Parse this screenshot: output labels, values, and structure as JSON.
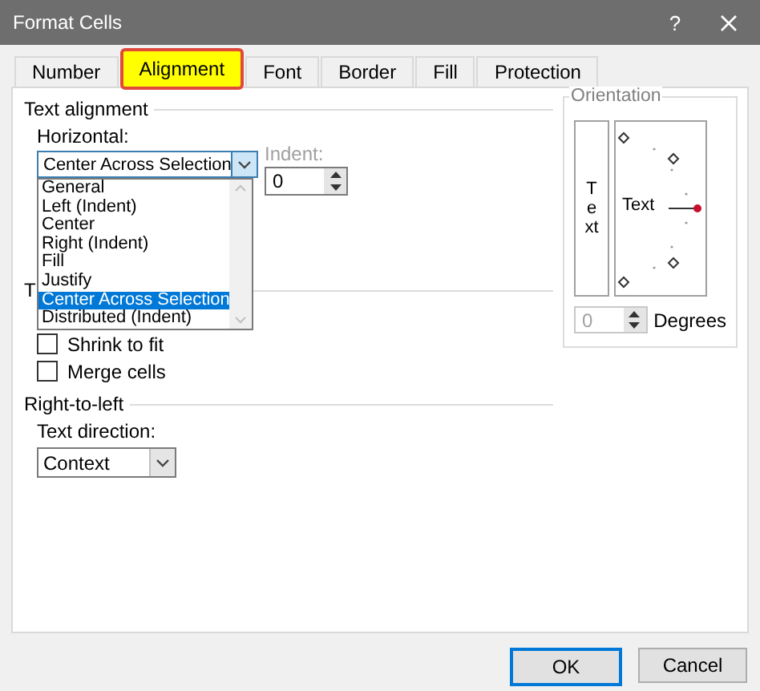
{
  "window": {
    "title": "Format Cells",
    "help": "?"
  },
  "tabs": [
    {
      "label": "Number",
      "selected": false
    },
    {
      "label": "Alignment",
      "selected": true
    },
    {
      "label": "Font",
      "selected": false
    },
    {
      "label": "Border",
      "selected": false
    },
    {
      "label": "Fill",
      "selected": false
    },
    {
      "label": "Protection",
      "selected": false
    }
  ],
  "text_alignment": {
    "label": "Text alignment",
    "horizontal_label": "Horizontal:",
    "horizontal_value": "Center Across Selection",
    "expanded": true,
    "options": [
      {
        "label": "General",
        "selected": false
      },
      {
        "label": "Left (Indent)",
        "selected": false
      },
      {
        "label": "Center",
        "selected": false
      },
      {
        "label": "Right (Indent)",
        "selected": false
      },
      {
        "label": "Fill",
        "selected": false
      },
      {
        "label": "Justify",
        "selected": false
      },
      {
        "label": "Center Across Selection",
        "selected": true
      },
      {
        "label": "Distributed (Indent)",
        "selected": false
      }
    ],
    "indent_label": "Indent:",
    "indent_value": "0"
  },
  "text_control": {
    "label": "T",
    "checkboxes": [
      {
        "label": "Shrink to fit",
        "checked": false
      },
      {
        "label": "Merge cells",
        "checked": false
      }
    ]
  },
  "right_to_left": {
    "label": "Right-to-left",
    "direction_label": "Text direction:",
    "direction_value": "Context"
  },
  "orientation": {
    "label": "Orientation",
    "vertical_text": "Text",
    "dial_text": "Text",
    "degrees_value": "0",
    "degrees_label": "Degrees",
    "degrees_disabled": true
  },
  "buttons": [
    {
      "label": "OK",
      "default": true
    },
    {
      "label": "Cancel",
      "default": false
    }
  ]
}
